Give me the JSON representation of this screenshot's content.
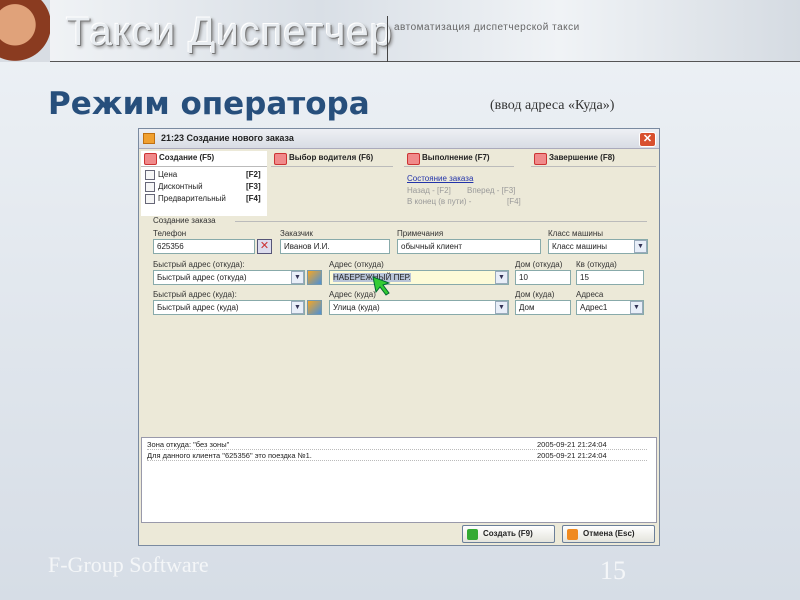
{
  "banner": {
    "brand": "Такси Диспетчер",
    "tagline": "автоматизация диспетчерской такси"
  },
  "slide": {
    "title": "Режим оператора",
    "subtitle": "(ввод адреса «Куда»)",
    "footer": "F-Group Software",
    "page": "15"
  },
  "window": {
    "title": "21:23 Создание нового заказа",
    "tabs": [
      "Создание (F5)",
      "Выбор водителя (F6)",
      "Выполнение (F7)",
      "Завершение (F8)"
    ],
    "options": [
      {
        "label": "Цена",
        "key": "[F2]"
      },
      {
        "label": "Дисконтный",
        "key": "[F3]"
      },
      {
        "label": "Предварительный",
        "key": "[F4]"
      }
    ],
    "status": {
      "link": "Состояние заказа",
      "back": "Назад - [F2]",
      "forward": "Вперед - [F3]",
      "end": "В конец (в пути) -",
      "end_key": "[F4]"
    },
    "section": "Создание заказа",
    "fields": {
      "phone": {
        "label": "Телефон",
        "value": "625356"
      },
      "customer": {
        "label": "Заказчик",
        "value": "Иванов И.И."
      },
      "notes": {
        "label": "Примечания",
        "value": "обычный клиент"
      },
      "car_class": {
        "label": "Класс машины",
        "value": "Класс машины"
      },
      "quick_from": {
        "label": "Быстрый адрес (откуда):",
        "value": "Быстрый адрес (откуда)"
      },
      "addr_from": {
        "label": "Адрес (откуда)",
        "value": "НАБЕРЕЖНЫЙ ПЕР."
      },
      "house_from": {
        "label": "Дом (откуда)",
        "value": "10"
      },
      "apt_from": {
        "label": "Кв (откуда)",
        "value": "15"
      },
      "quick_to": {
        "label": "Быстрый адрес (куда):",
        "value": "Быстрый адрес (куда)"
      },
      "addr_to": {
        "label": "Адрес (куда)",
        "value": "Улица (куда)"
      },
      "house_to": {
        "label": "Дом (куда)",
        "value": "Дом"
      },
      "addresses": {
        "label": "Адреса",
        "value": "Адрес1"
      }
    },
    "log": [
      {
        "text": "Зона откуда: \"без зоны\"",
        "time": "2005-09-21 21:24:04"
      },
      {
        "text": "Для данного клиента \"625356\" это поездка №1.",
        "time": "2005-09-21 21:24:04"
      }
    ],
    "buttons": {
      "create": "Создать (F9)",
      "cancel": "Отмена (Esc)"
    }
  }
}
